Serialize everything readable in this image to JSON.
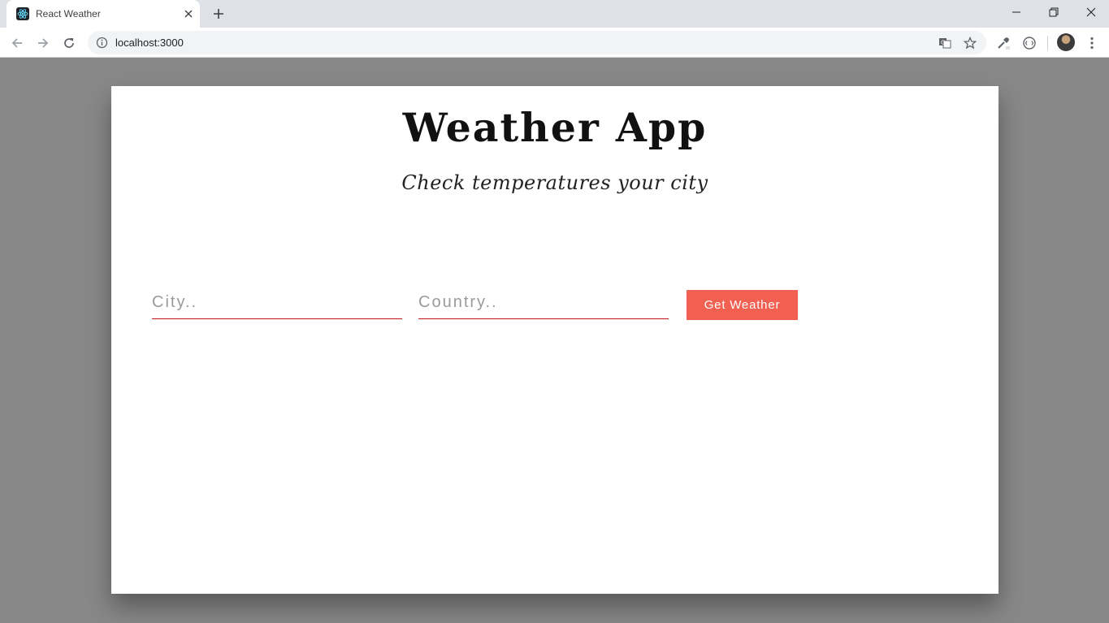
{
  "browser": {
    "tab": {
      "title": "React Weather",
      "favicon": "react-logo-icon"
    },
    "address_bar": {
      "url": "localhost:3000"
    },
    "icons": {
      "back": "arrow-left-icon",
      "forward": "arrow-right-icon",
      "reload": "reload-icon",
      "info": "info-icon",
      "translate": "translate-icon",
      "bookmark": "star-icon",
      "eyedropper": "eyedropper-icon",
      "extension": "extension-icon",
      "menu": "more-vert-icon"
    }
  },
  "page": {
    "title": "Weather App",
    "subtitle": "Check temperatures your city",
    "form": {
      "city_placeholder": "City..",
      "city_value": "",
      "country_placeholder": "Country..",
      "country_value": "",
      "submit_label": "Get Weather"
    }
  },
  "colors": {
    "accent": "#f16051",
    "input_underline": "#c3141b",
    "page_background": "#888888",
    "card_background": "#ffffff"
  }
}
